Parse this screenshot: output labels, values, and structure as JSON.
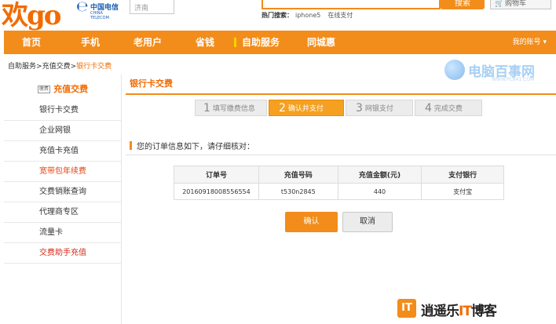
{
  "header": {
    "logo_text": "go",
    "logo_prefix": "欢",
    "telecom_cn": "中国电信",
    "telecom_en": "CHINA TELECOM",
    "city": "济南",
    "search_button": "搜索",
    "cart_label": "购物车",
    "hot_label": "热门搜索：",
    "hot_items": [
      "iphone5",
      "在线支付"
    ]
  },
  "nav": {
    "items": [
      "首页",
      "手机",
      "老用户",
      "省钱",
      "自助服务",
      "同城惠"
    ],
    "account": "我的账号 ▾"
  },
  "breadcrumb": {
    "part1": "自助服务",
    "sep": ">",
    "part2": "充值交费",
    "current": "银行卡交费"
  },
  "watermark_top": {
    "cn": "电脑百事网",
    "en": "WWW.PC841.COM"
  },
  "sidebar": {
    "icon_text": "缴费",
    "title": "充值交费",
    "items": [
      {
        "label": "银行卡交费",
        "style": "normal"
      },
      {
        "label": "企业网银",
        "style": "normal"
      },
      {
        "label": "充值卡充值",
        "style": "normal"
      },
      {
        "label": "宽带包年续费",
        "style": "hl"
      },
      {
        "label": "交费销账查询",
        "style": "normal"
      },
      {
        "label": "代理商专区",
        "style": "normal"
      },
      {
        "label": "流量卡",
        "style": "normal"
      },
      {
        "label": "交费助手充值",
        "style": "red"
      }
    ]
  },
  "panel": {
    "title": "银行卡交费",
    "steps": [
      {
        "num": "1",
        "label": "填写缴费信息"
      },
      {
        "num": "2",
        "label": "确认并支付"
      },
      {
        "num": "3",
        "label": "网银支付"
      },
      {
        "num": "4",
        "label": "完成交费"
      }
    ],
    "order_heading": "您的订单信息如下，请仔细核对：",
    "table": {
      "headers": [
        "订单号",
        "充值号码",
        "充值金额(元)",
        "支付银行"
      ],
      "row": [
        "20160918008556554",
        "t530n2845",
        "440",
        "支付宝"
      ]
    },
    "confirm": "确认",
    "cancel": "取消"
  },
  "watermark_bottom": {
    "icon": "IT",
    "text_a": "逍遥乐",
    "text_b": "IT",
    "text_c": "博客"
  },
  "colors": {
    "brand_orange": "#f28c1a",
    "accent_text": "#f26b00",
    "step_active": "#f5a021"
  }
}
